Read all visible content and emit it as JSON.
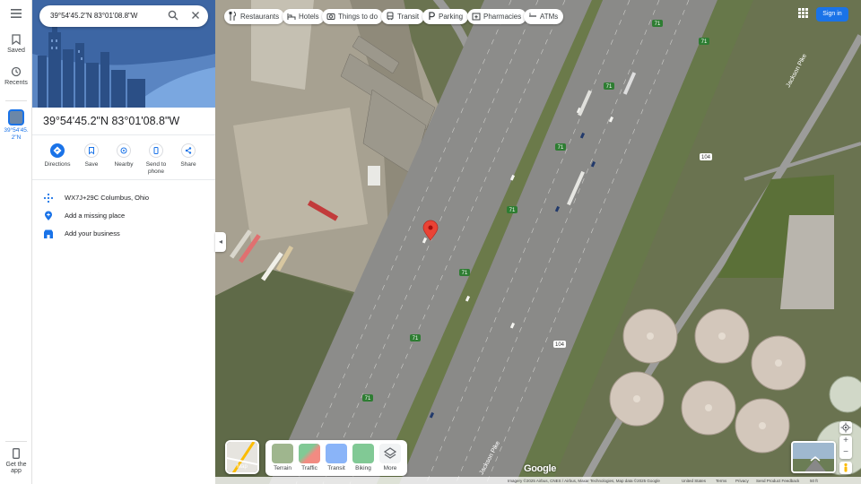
{
  "search": {
    "value": "39°54'45.2\"N 83°01'08.8\"W"
  },
  "rail": {
    "saved": "Saved",
    "recents": "Recents",
    "place_line1": "39°54'45.",
    "place_line2": "2\"N",
    "get_app_line1": "Get the",
    "get_app_line2": "app"
  },
  "place": {
    "title": "39°54'45.2\"N 83°01'08.8\"W",
    "actions": [
      "Directions",
      "Save",
      "Nearby",
      "Send to",
      "phone",
      "Share"
    ],
    "plus_code": "WX7J+29C Columbus, Ohio",
    "add_place": "Add a missing place",
    "add_business": "Add your business"
  },
  "chips": [
    "Restaurants",
    "Hotels",
    "Things to do",
    "Transit",
    "Parking",
    "Pharmacies",
    "ATMs"
  ],
  "signin": "Sign in",
  "layers": {
    "main": "Map",
    "options": [
      "Terrain",
      "Traffic",
      "Transit",
      "Biking",
      "More"
    ]
  },
  "map_labels": {
    "route": "71",
    "route_104": "104",
    "pike": "Jackson Pike",
    "logo": "Google"
  },
  "footer": {
    "imagery": "Imagery ©2025 Airbus, CNES / Airbus, Maxar Technologies, Map data ©2025 Google",
    "country": "United States",
    "terms": "Terms",
    "privacy": "Privacy",
    "feedback": "Send Product Feedback",
    "scale": "50 ft"
  },
  "colors": {
    "accent": "#1a73e8",
    "pin": "#ea4335",
    "highway": "#8f8f8f",
    "grass": "#556b3a"
  }
}
